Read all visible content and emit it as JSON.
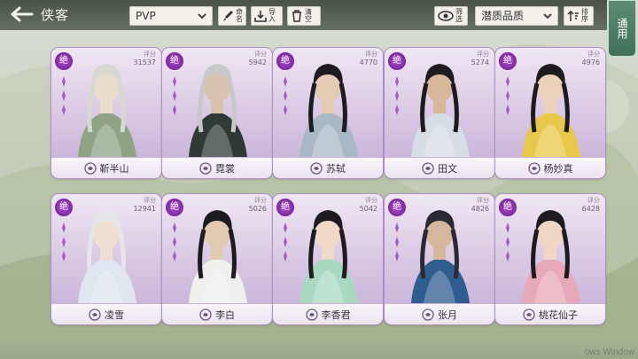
{
  "header": {
    "title": "侠客",
    "mode_select": "PVP",
    "buttons": [
      {
        "label": "命名"
      },
      {
        "label": "导入"
      },
      {
        "label": "清空"
      }
    ],
    "filter_label": "筛选",
    "quality_select": "潜质品质",
    "sort_label": "排序",
    "side_tab_label": "通用"
  },
  "score_label": "评分",
  "cards": [
    {
      "name": "靳半山",
      "badge": "绝",
      "score": "31537"
    },
    {
      "name": "霓裳",
      "badge": "绝",
      "score": "5942"
    },
    {
      "name": "苏轼",
      "badge": "绝",
      "score": "4770"
    },
    {
      "name": "田文",
      "badge": "绝",
      "score": "5274"
    },
    {
      "name": "杨妙真",
      "badge": "绝",
      "score": "4976"
    },
    {
      "name": "凌雪",
      "badge": "绝",
      "score": "12941"
    },
    {
      "name": "李白",
      "badge": "绝",
      "score": "5026"
    },
    {
      "name": "李香君",
      "badge": "绝",
      "score": "5042"
    },
    {
      "name": "张月",
      "badge": "绝",
      "score": "4826"
    },
    {
      "name": "桃花仙子",
      "badge": "绝",
      "score": "6428"
    }
  ],
  "watermark": "ows Window",
  "colors": {
    "accent": "#7a2b9b",
    "card_bg": "#d7c6e2",
    "topbar": "#3c463a",
    "side_tab": "#41705a"
  }
}
